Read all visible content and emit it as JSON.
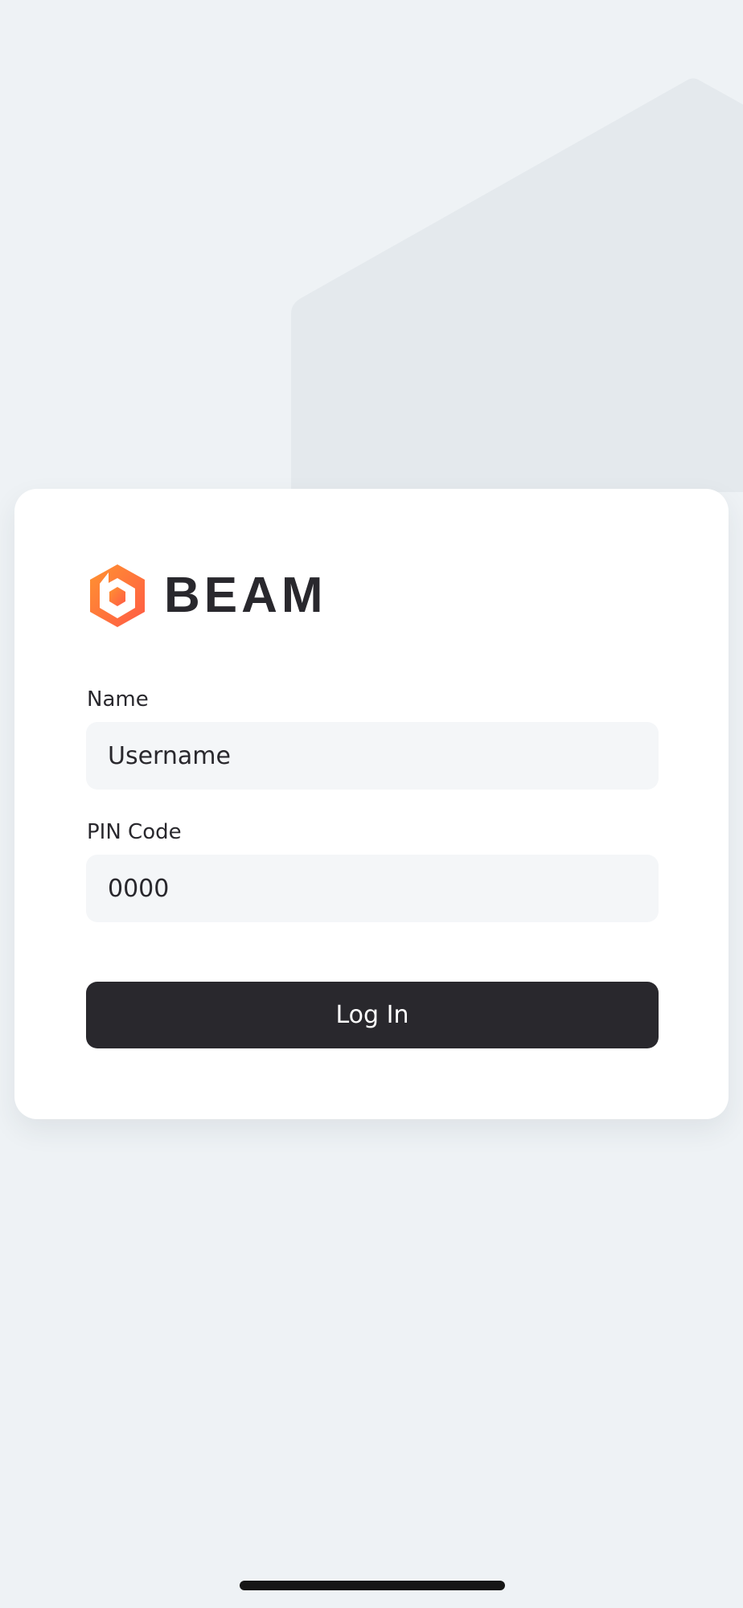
{
  "brand": {
    "name": "BEAM",
    "logo_icon": "beam-hexagon-logo",
    "accent_colors": [
      "#ff8a2a",
      "#ff5a46"
    ]
  },
  "login": {
    "name_label": "Name",
    "name_placeholder": "Username",
    "pin_label": "PIN Code",
    "pin_placeholder": "0000",
    "button_label": "Log In"
  },
  "colors": {
    "background": "#eef2f5",
    "card": "#ffffff",
    "input_background": "#f4f6f8",
    "button_background": "#29282d",
    "button_text": "#ffffff"
  }
}
